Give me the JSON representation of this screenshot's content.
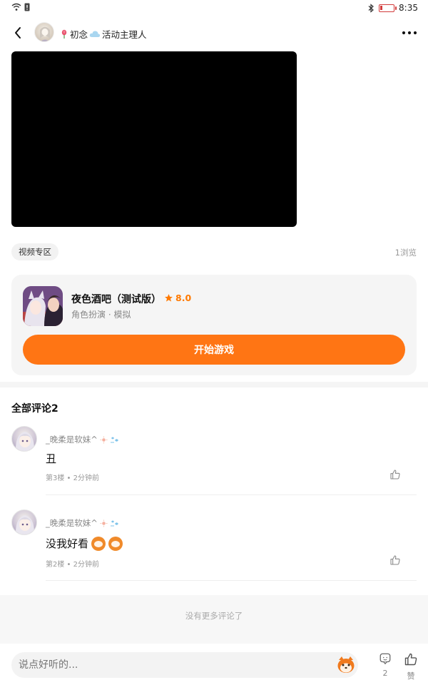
{
  "status_bar": {
    "time": "8:35",
    "battery_level": 0.15
  },
  "header": {
    "author_name": "初念",
    "author_role": "活动主理人"
  },
  "post": {
    "tag": "视频专区",
    "views": "1浏览"
  },
  "game": {
    "title": "夜色酒吧（测试版）",
    "rating": "8.0",
    "subtitle": "角色扮演 · 模拟",
    "start_label": "开始游戏"
  },
  "comments": {
    "title": "全部评论2",
    "items": [
      {
        "user": "_晚柔是软妹^",
        "text": "丑",
        "meta": "第3楼 • 2分钟前"
      },
      {
        "user": "_晚柔是软妹^",
        "text": "没我好看",
        "meta": "第2楼 • 2分钟前"
      }
    ],
    "no_more": "没有更多评论了"
  },
  "bottom_bar": {
    "input_placeholder": "说点好听的...",
    "comment_count": "2",
    "like_label": "赞"
  },
  "colors": {
    "accent": "#ff7514",
    "rating": "#ff7a00"
  }
}
